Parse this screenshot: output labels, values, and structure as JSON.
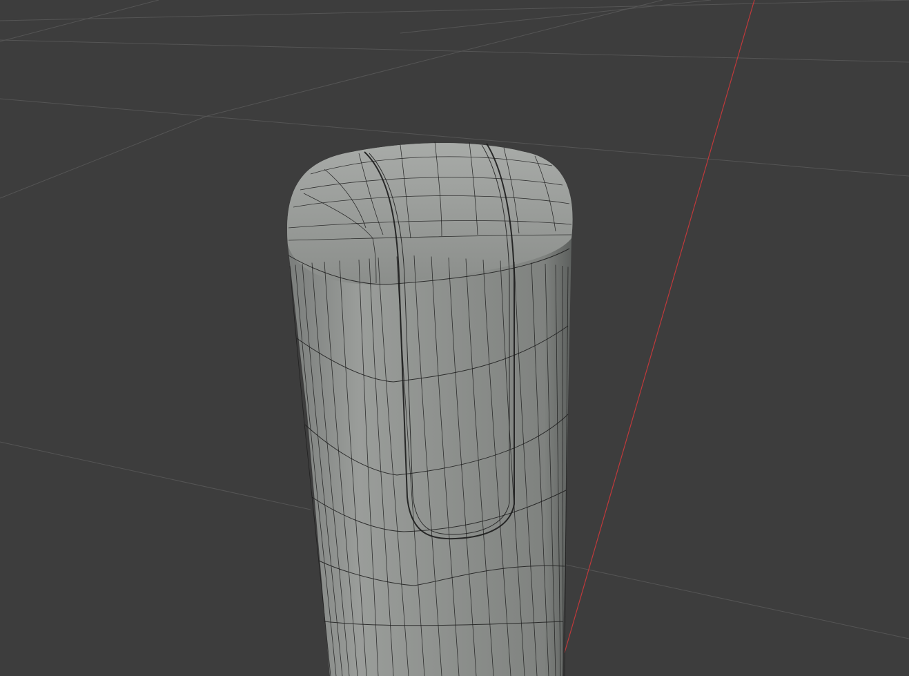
{
  "viewport": {
    "background_color": "#3d3d3d",
    "grid_color": "#555555",
    "x_axis_color": "#c0393b",
    "mesh_fill_color": "#8c8f8c",
    "mesh_highlight_color": "#a3a6a3",
    "mesh_shadow_color": "#6f7270",
    "wire_color": "#1b1b1b",
    "object": "subdivided-cylinder-mesh",
    "shading": "solid",
    "overlay": "wireframe"
  }
}
